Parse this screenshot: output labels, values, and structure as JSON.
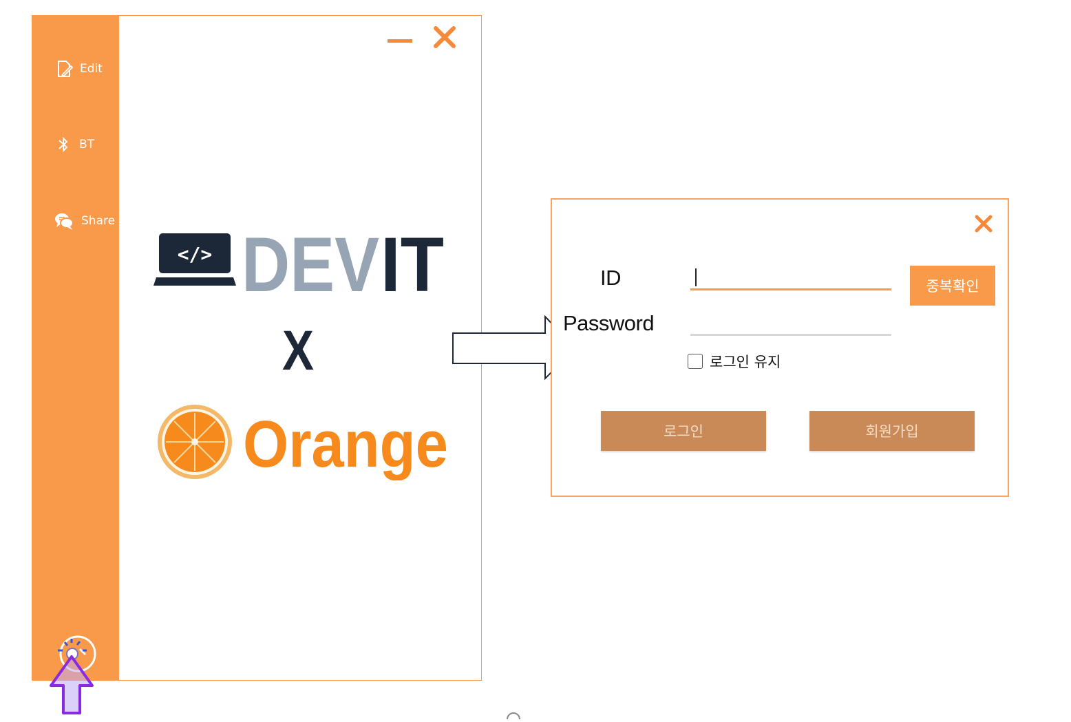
{
  "colors": {
    "accent": "#f99a4a",
    "button_muted": "#c98a58",
    "logo_slate": "#96a4b4",
    "logo_navy": "#1c2737",
    "logo_orange": "#f78a1c"
  },
  "main_window": {
    "sidebar": {
      "items": [
        {
          "label": "Edit",
          "icon": "edit-icon"
        },
        {
          "label": "BT",
          "icon": "bluetooth-icon"
        },
        {
          "label": "Share",
          "icon": "chat-share-icon"
        }
      ],
      "bottom_icon": "settings-icon"
    },
    "logo": {
      "laptop_code": "</>",
      "devit_prefix": "DEV",
      "devit_suffix": "IT",
      "cross": "X",
      "orange_text": "Orange"
    }
  },
  "login": {
    "id_label": "ID",
    "password_label": "Password",
    "id_value": "",
    "password_value": "",
    "dup_check_label": "중복확인",
    "keep_login_label": "로그인 유지",
    "keep_login_checked": false,
    "login_button": "로그인",
    "signup_button": "회원가입"
  }
}
